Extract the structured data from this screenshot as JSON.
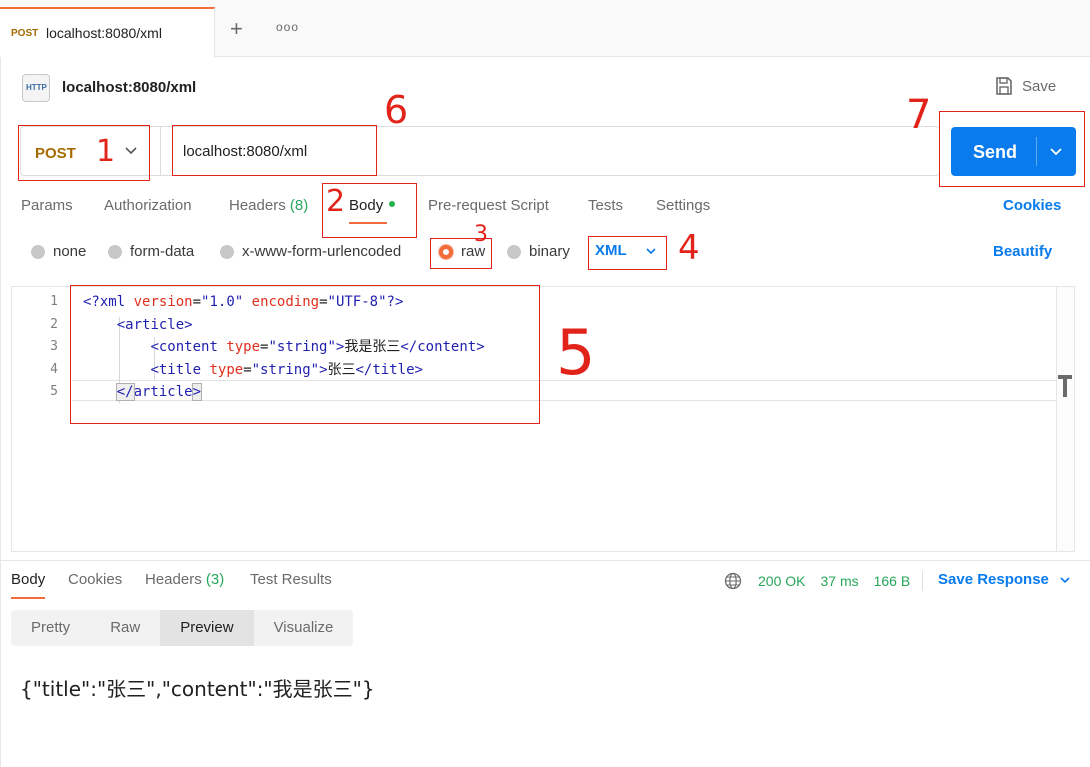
{
  "tab": {
    "method": "POST",
    "title": "localhost:8080/xml"
  },
  "tabstrip": {
    "new_tab": "+",
    "more": "ooo"
  },
  "header": {
    "icon_label": "HTTP",
    "name": "localhost:8080/xml",
    "save_label": "Save"
  },
  "request": {
    "method": "POST",
    "url": "localhost:8080/xml",
    "send_label": "Send"
  },
  "request_tabs": {
    "params": "Params",
    "authorization": "Authorization",
    "headers": "Headers",
    "headers_count": "(8)",
    "body": "Body",
    "pre_request": "Pre-request Script",
    "tests": "Tests",
    "settings": "Settings",
    "cookies": "Cookies"
  },
  "body_types": {
    "none": "none",
    "form_data": "form-data",
    "urlencoded": "x-www-form-urlencoded",
    "raw": "raw",
    "binary": "binary",
    "selected": "raw",
    "language": "XML",
    "beautify": "Beautify"
  },
  "editor": {
    "line_numbers": [
      "1",
      "2",
      "3",
      "4",
      "5"
    ],
    "lines": [
      "<?xml version=\"1.0\" encoding=\"UTF-8\"?>",
      "    <article>",
      "        <content type=\"string\">我是张三</content>",
      "        <title type=\"string\">张三</title>",
      "    </article>"
    ]
  },
  "response_tabs": {
    "body": "Body",
    "cookies": "Cookies",
    "headers": "Headers",
    "headers_count": "(3)",
    "test_results": "Test Results"
  },
  "response_status": {
    "status": "200 OK",
    "time": "37 ms",
    "size": "166 B",
    "save_response": "Save Response"
  },
  "view_modes": {
    "pretty": "Pretty",
    "raw": "Raw",
    "preview": "Preview",
    "visualize": "Visualize",
    "selected": "Preview"
  },
  "response_body": "{\"title\":\"张三\",\"content\":\"我是张三\"}",
  "annotations": [
    "1",
    "2",
    "3",
    "4",
    "5",
    "6",
    "7"
  ],
  "colors": {
    "accent": "#f26b3a",
    "primary": "#097bed",
    "post": "#a66a00",
    "success": "#26a65b",
    "annotation": "#e2231a"
  }
}
